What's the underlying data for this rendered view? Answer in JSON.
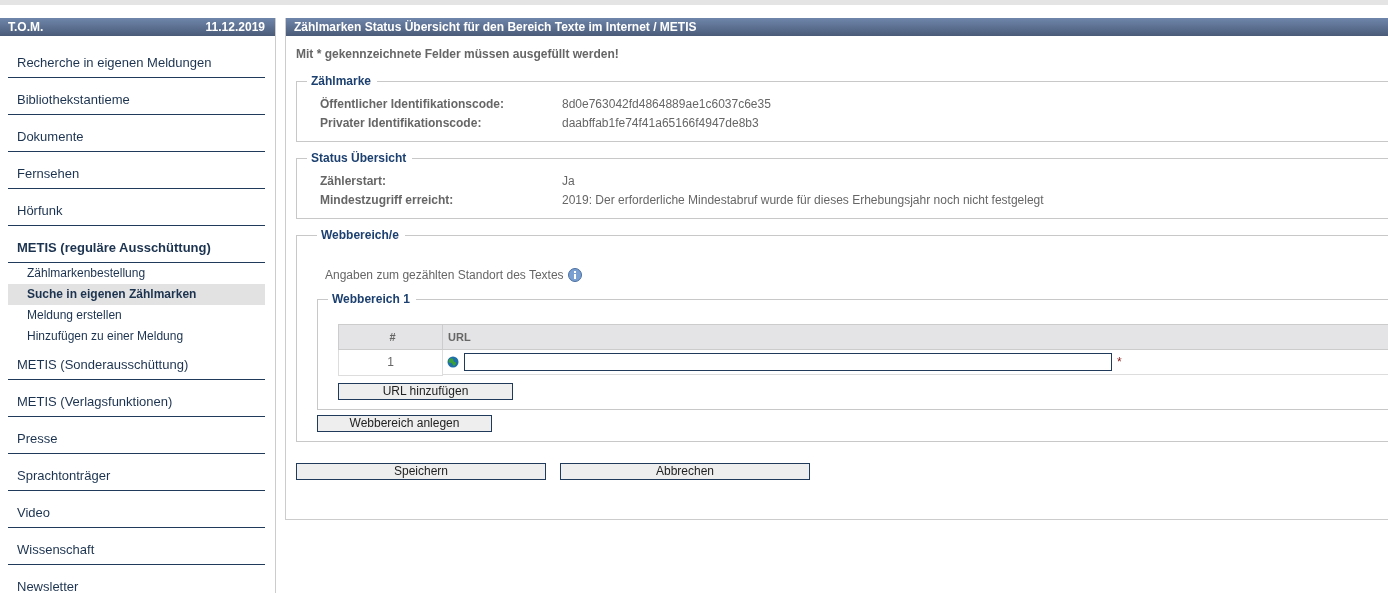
{
  "sidebar": {
    "title": "T.O.M.",
    "date": "11.12.2019",
    "items": [
      {
        "label": "Recherche in eigenen Meldungen",
        "selected": false
      },
      {
        "label": "Bibliothekstantieme",
        "selected": false
      },
      {
        "label": "Dokumente",
        "selected": false
      },
      {
        "label": "Fernsehen",
        "selected": false
      },
      {
        "label": "Hörfunk",
        "selected": false
      },
      {
        "label": "METIS (reguläre Ausschüttung)",
        "selected": true,
        "children": [
          {
            "label": "Zählmarkenbestellung",
            "selected": false
          },
          {
            "label": "Suche in eigenen Zählmarken",
            "selected": true
          },
          {
            "label": "Meldung erstellen",
            "selected": false
          },
          {
            "label": "Hinzufügen zu einer Meldung",
            "selected": false
          }
        ]
      },
      {
        "label": "METIS (Sonderausschüttung)",
        "selected": false
      },
      {
        "label": "METIS (Verlagsfunktionen)",
        "selected": false
      },
      {
        "label": "Presse",
        "selected": false
      },
      {
        "label": "Sprachtonträger",
        "selected": false
      },
      {
        "label": "Video",
        "selected": false
      },
      {
        "label": "Wissenschaft",
        "selected": false
      },
      {
        "label": "Newsletter",
        "selected": false
      }
    ]
  },
  "main": {
    "title": "Zählmarken Status Übersicht für den Bereich Texte im Internet / METIS",
    "required_note": "Mit * gekennzeichnete Felder müssen ausgefüllt werden!",
    "sections": [
      {
        "legend": "Zählmarke",
        "rows": [
          {
            "label": "Öffentlicher Identifikationscode:",
            "value": "8d0e763042fd4864889ae1c6037c6e35"
          },
          {
            "label": "Privater Identifikationscode:",
            "value": "daabffab1fe74f41a65166f4947de8b3"
          }
        ]
      },
      {
        "legend": "Status Übersicht",
        "rows": [
          {
            "label": "Zählerstart:",
            "value": "Ja"
          },
          {
            "label": "Mindestzugriff erreicht:",
            "value": "2019: Der erforderliche Mindestabruf wurde für dieses Erhebungsjahr noch nicht festgelegt"
          }
        ]
      }
    ],
    "web": {
      "legend": "Webbereich/e",
      "hint": "Angaben zum gezählten Standort des Textes",
      "areas": [
        {
          "legend": "Webbereich 1",
          "columns": [
            "#",
            "URL"
          ],
          "rows": [
            {
              "index": "1",
              "required_mark": "*"
            }
          ],
          "add_button": "URL hinzufügen"
        }
      ],
      "add_area_button": "Webbereich anlegen"
    },
    "buttons": [
      "Speichern",
      "Abbrechen"
    ]
  }
}
